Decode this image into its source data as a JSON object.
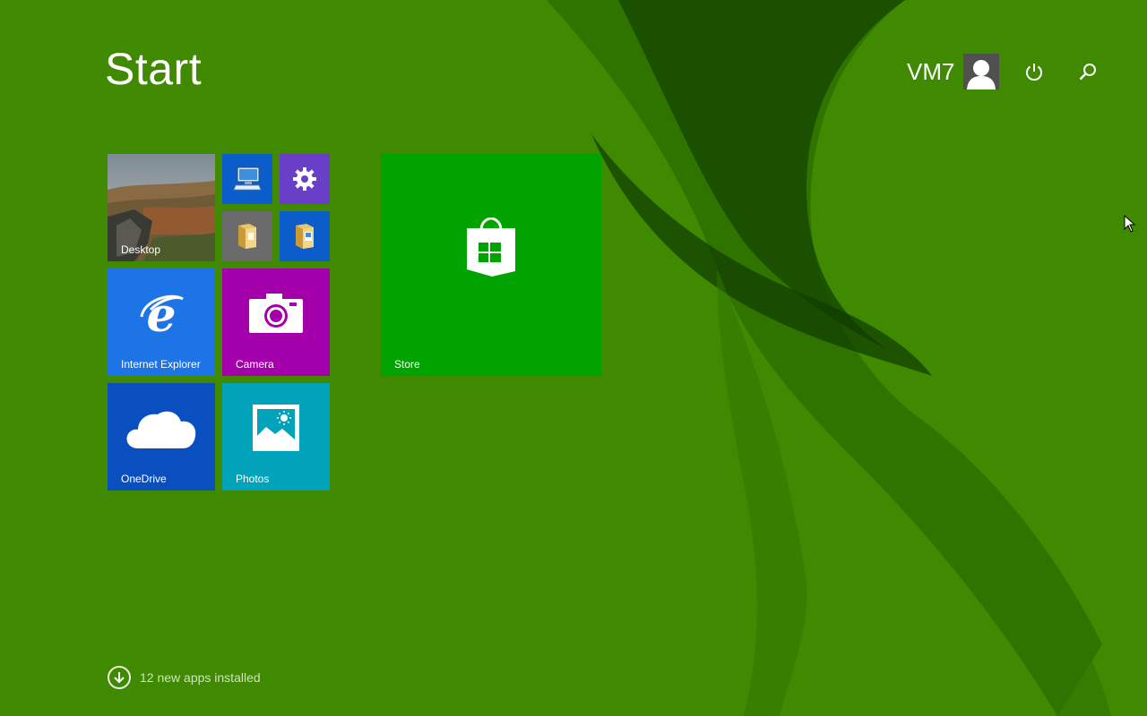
{
  "screen": {
    "title": "Start"
  },
  "user": {
    "name": "VM7"
  },
  "header_icons": [
    "power-icon",
    "search-icon"
  ],
  "colors": {
    "background": "#3f8a00",
    "store_tile": "#00a300",
    "ie_tile": "#1e73e6",
    "camera_tile": "#a300ab",
    "onedrive_tile": "#0a4fbf",
    "photos_tile": "#00a3ba",
    "settings_tile": "#6a3fc7",
    "computer_tile": "#0b5ec9",
    "explorer_tile": "#6b6b6b",
    "documents_tile": "#0b5ec9"
  },
  "tiles": {
    "desktop": {
      "label": "Desktop"
    },
    "this_pc": {
      "label": "",
      "icon": "computer-icon"
    },
    "pc_settings": {
      "label": "",
      "icon": "gear-icon"
    },
    "file_explorer": {
      "label": "",
      "icon": "folder-icon"
    },
    "documents": {
      "label": "",
      "icon": "documents-folder-icon"
    },
    "internet_explorer": {
      "label": "Internet Explorer",
      "icon": "ie-icon"
    },
    "camera": {
      "label": "Camera",
      "icon": "camera-icon"
    },
    "onedrive": {
      "label": "OneDrive",
      "icon": "cloud-icon"
    },
    "photos": {
      "label": "Photos",
      "icon": "photo-icon"
    },
    "store": {
      "label": "Store",
      "icon": "store-bag-icon"
    }
  },
  "footer": {
    "text": "12 new apps installed",
    "icon": "down-arrow-circle-icon"
  }
}
